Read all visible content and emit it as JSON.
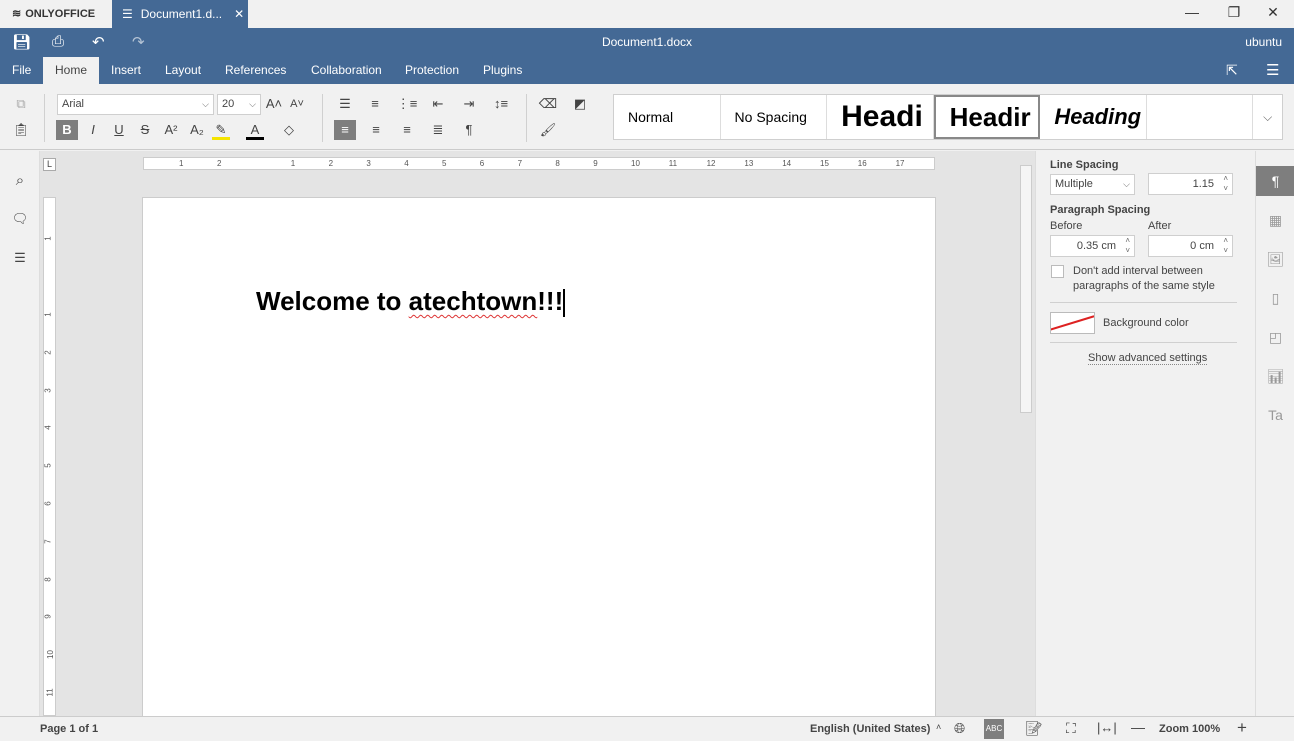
{
  "app": {
    "brand": "ONLYOFFICE",
    "tab_title": "Document1.d...",
    "doc_title": "Document1.docx",
    "user": "ubuntu"
  },
  "menu": {
    "tabs": [
      "File",
      "Home",
      "Insert",
      "Layout",
      "References",
      "Collaboration",
      "Protection",
      "Plugins"
    ],
    "active": "Home"
  },
  "toolbar": {
    "font_name": "Arial",
    "font_size": "20",
    "styles": [
      "Normal",
      "No Spacing",
      "Headi",
      "Headir",
      "Heading"
    ],
    "highlight_color": "#f5e400",
    "font_color": "#000000"
  },
  "ruler": {
    "h": [
      "2",
      "1",
      "1",
      "2",
      "3",
      "4",
      "5",
      "6",
      "7",
      "8",
      "9",
      "10",
      "11",
      "12",
      "13",
      "14",
      "15",
      "16",
      "17"
    ],
    "v": [
      "1",
      "1",
      "2",
      "3",
      "4",
      "5",
      "6",
      "7",
      "8",
      "9",
      "10",
      "11"
    ]
  },
  "document": {
    "text_plain": "Welcome to ",
    "text_misspelled": "atechtown",
    "text_end": "!!!"
  },
  "panel": {
    "line_spacing_label": "Line Spacing",
    "line_spacing_mode": "Multiple",
    "line_spacing_value": "1.15",
    "paragraph_spacing_label": "Paragraph Spacing",
    "before_label": "Before",
    "before_value": "0.35 cm",
    "after_label": "After",
    "after_value": "0 cm",
    "dont_add_interval": "Don't add interval between paragraphs of the same style",
    "dont_add_checked": false,
    "background_color_label": "Background color",
    "advanced": "Show advanced settings"
  },
  "status": {
    "page": "Page 1 of 1",
    "language": "English (United States)",
    "zoom": "Zoom 100%"
  },
  "colors": {
    "header": "#446995",
    "accent_active": "#7e7e7e",
    "spell_error": "#dd3333"
  }
}
